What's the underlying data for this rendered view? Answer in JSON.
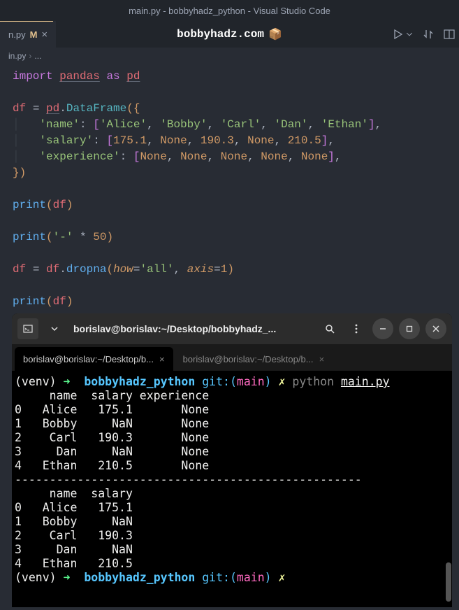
{
  "window_title": "main.py - bobbyhadz_python - Visual Studio Code",
  "tab": {
    "label": "n.py",
    "mod": "M"
  },
  "banner": {
    "text": "bobbyhadz.com",
    "icon": "📦"
  },
  "breadcrumb": {
    "file": "in.py",
    "rest": "..."
  },
  "code": {
    "l1": {
      "import": "import",
      "pandas": "pandas",
      "as": "as",
      "pd": "pd"
    },
    "l3": {
      "df": "df",
      "eq": "=",
      "pd": "pd",
      "dot": ".",
      "DataFrame": "DataFrame",
      "open": "({"
    },
    "l4": {
      "name": "'name'",
      "col": ":",
      "open": "[",
      "alice": "'Alice'",
      "bobby": "'Bobby'",
      "carl": "'Carl'",
      "dan": "'Dan'",
      "ethan": "'Ethan'",
      "close": "]",
      "comma": ","
    },
    "l5": {
      "salary": "'salary'",
      "col": ":",
      "open": "[",
      "v1": "175.1",
      "none1": "None",
      "v2": "190.3",
      "none2": "None",
      "v3": "210.5",
      "close": "]",
      "comma": ","
    },
    "l6": {
      "exp": "'experience'",
      "col": ":",
      "open": "[",
      "n1": "None",
      "n2": "None",
      "n3": "None",
      "n4": "None",
      "n5": "None",
      "close": "]",
      "comma": ","
    },
    "l7": {
      "close": "})"
    },
    "l9": {
      "print": "print",
      "open": "(",
      "df": "df",
      "close": ")"
    },
    "l11": {
      "print": "print",
      "open": "(",
      "dash": "'-'",
      "mul": "*",
      "fifty": "50",
      "close": ")"
    },
    "l13": {
      "df": "df",
      "eq": "=",
      "df2": "df",
      "dot": ".",
      "dropna": "dropna",
      "open": "(",
      "how": "how",
      "eq2": "=",
      "all": "'all'",
      "comma": ",",
      "axis": "axis",
      "eq3": "=",
      "one": "1",
      "close": ")"
    },
    "l15": {
      "print": "print",
      "open": "(",
      "df": "df",
      "close": ")"
    }
  },
  "terminal": {
    "title": "borislav@borislav:~/Desktop/bobbyhadz_...",
    "tab1": "borislav@borislav:~/Desktop/b...",
    "tab2": "borislav@borislav:~/Desktop/b...",
    "prompt": {
      "venv": "(venv)",
      "arrow": "➜",
      "dir": "bobbyhadz_python",
      "git": "git:(",
      "branch": "main",
      "close": ")",
      "x": "✗",
      "cmd": "python",
      "file": "main.py"
    },
    "out_header1": "     name  salary experience",
    "rows1": [
      "0   Alice   175.1       None",
      "1   Bobby     NaN       None",
      "2    Carl   190.3       None",
      "3     Dan     NaN       None",
      "4   Ethan   210.5       None"
    ],
    "sep": "--------------------------------------------------",
    "out_header2": "     name  salary",
    "rows2": [
      "0   Alice   175.1",
      "1   Bobby     NaN",
      "2    Carl   190.3",
      "3     Dan     NaN",
      "4   Ethan   210.5"
    ]
  }
}
